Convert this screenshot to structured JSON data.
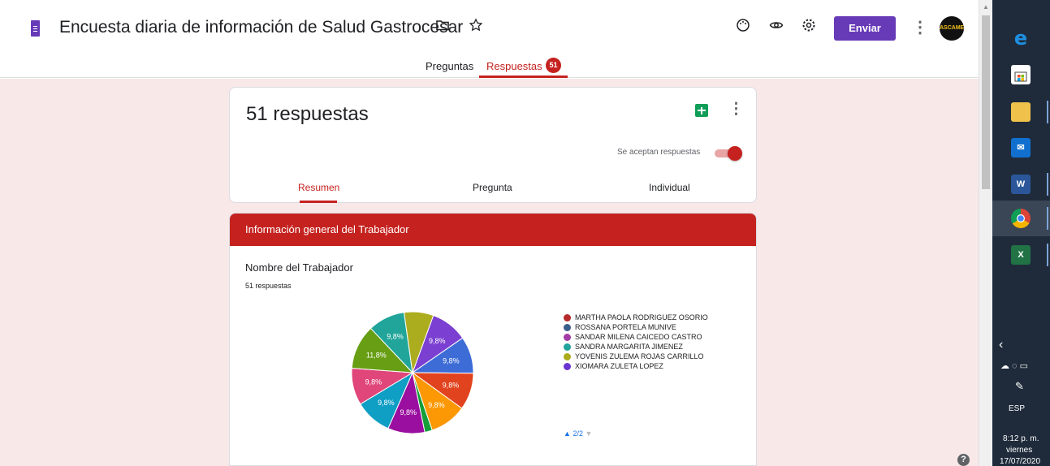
{
  "header": {
    "title": "Encuesta diaria de información de Salud Gastrocesar",
    "send_label": "Enviar",
    "avatar_text": "ASCAMEV",
    "icons": [
      "forms-logo-icon",
      "folder-icon",
      "star-icon",
      "palette-icon",
      "eye-icon",
      "gear-icon",
      "more-vert-icon"
    ],
    "accent_color": "#673ab7"
  },
  "tabs": {
    "questions_label": "Preguntas",
    "responses_label": "Respuestas",
    "responses_badge": "51",
    "active": "Respuestas"
  },
  "summary": {
    "count_label": "51 respuestas",
    "accepting_label": "Se aceptan respuestas",
    "accepting": true,
    "subtabs": [
      "Resumen",
      "Pregunta",
      "Individual"
    ],
    "active_subtab": "Resumen"
  },
  "section": {
    "title": "Información general del Trabajador",
    "color": "#c5221f"
  },
  "question": {
    "title": "Nombre del Trabajador",
    "count": "51 respuestas",
    "pager": "2/2"
  },
  "chart_data": {
    "type": "pie",
    "slices": [
      {
        "label": "9,8%",
        "value": 9.8,
        "color": "#7b3fd1"
      },
      {
        "label": "9,8%",
        "value": 9.8,
        "color": "#3d6cd6"
      },
      {
        "label": "9,8%",
        "value": 9.8,
        "color": "#e1431e"
      },
      {
        "label": "9,8%",
        "value": 9.8,
        "color": "#fb9804"
      },
      {
        "label": "",
        "value": 2.0,
        "color": "#139e3a"
      },
      {
        "label": "9,8%",
        "value": 9.8,
        "color": "#9a0f9f"
      },
      {
        "label": "9,8%",
        "value": 9.8,
        "color": "#0f9ec4"
      },
      {
        "label": "9,8%",
        "value": 9.8,
        "color": "#e0467a"
      },
      {
        "label": "11,8%",
        "value": 11.8,
        "color": "#679e14"
      },
      {
        "label": "9,8%",
        "value": 9.8,
        "color": "#21a59a"
      },
      {
        "label": "",
        "value": 7.8,
        "color": "#acac1f"
      }
    ],
    "legend": [
      {
        "name": "MARTHA PAOLA RODRIGUEZ OSORIO",
        "color": "#b52b2b"
      },
      {
        "name": "ROSSANA PORTELA MUNIVE",
        "color": "#3c5f8a"
      },
      {
        "name": "SANDAR MILENA CAICEDO CASTRO",
        "color": "#a43ca4"
      },
      {
        "name": "SANDRA MARGARITA JIMENEZ",
        "color": "#22a39b"
      },
      {
        "name": "YOVENIS ZULEMA ROJAS CARRILLO",
        "color": "#abab1d"
      },
      {
        "name": "XIOMARA ZULETA LOPEZ",
        "color": "#6b35d1"
      }
    ]
  },
  "taskbar": {
    "apps": [
      "edge-icon",
      "store-icon",
      "explorer-icon",
      "mail-icon",
      "word-icon",
      "chrome-icon",
      "excel-icon"
    ],
    "lang": "ESP",
    "time": "8:12 p. m.",
    "day": "viernes",
    "date": "17/07/2020"
  }
}
